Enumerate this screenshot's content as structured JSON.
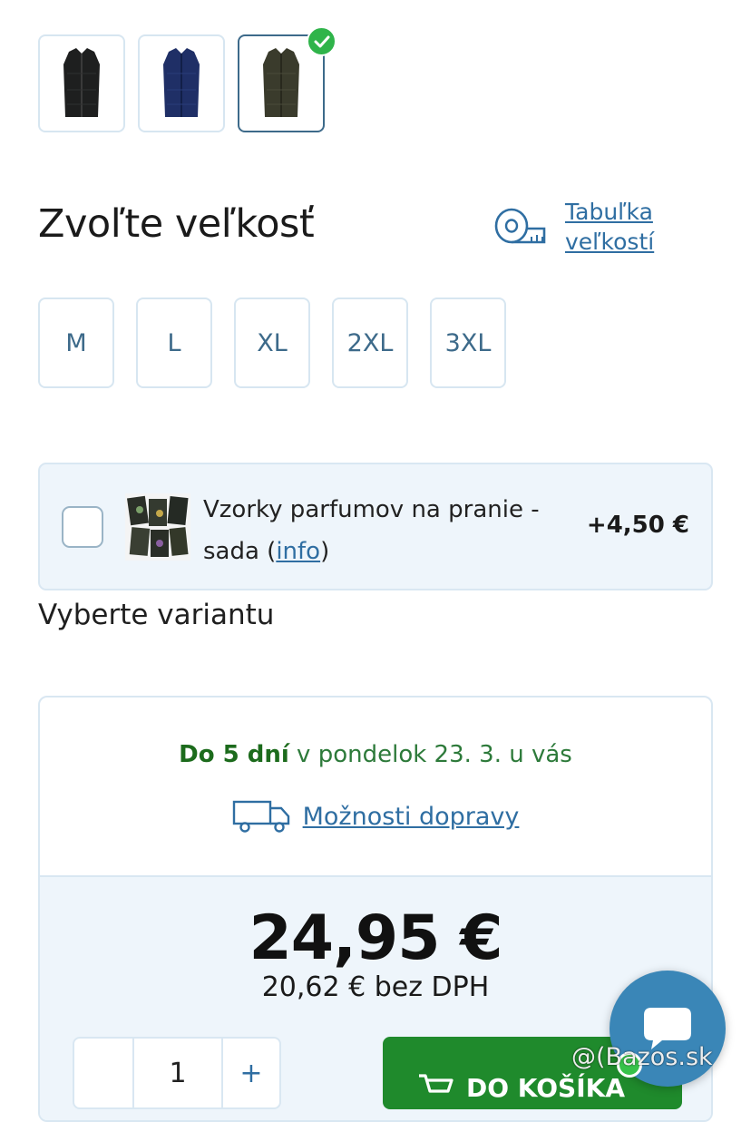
{
  "swatches": [
    {
      "name": "black",
      "color": "#1e1f1f"
    },
    {
      "name": "navy",
      "color": "#1f2f66"
    },
    {
      "name": "olive",
      "color": "#3a3b2c",
      "selected": true
    }
  ],
  "size_section": {
    "title": "Zvoľte veľkosť",
    "size_table_link_line1": "Tabuľka",
    "size_table_link_line2": "veľkostí",
    "sizes": [
      "M",
      "L",
      "XL",
      "2XL",
      "3XL"
    ]
  },
  "addon": {
    "text_main": "Vzorky parfumov na pranie - sada (",
    "info_link": "info",
    "text_close": ")",
    "price": "+4,50 €"
  },
  "variant_note": "Vyberte variantu",
  "delivery": {
    "days": "Do 5 dní",
    "rest": " v pondelok 23. 3. u vás",
    "shipping_link": "Možnosti dopravy"
  },
  "price": {
    "main": "24,95 €",
    "net": "20,62 € bez DPH"
  },
  "quantity": {
    "minus": "",
    "value": "1",
    "plus": "+"
  },
  "cart_button_label": "DO KOŠÍKA",
  "watermark": "@(Bazos.sk",
  "colors": {
    "link": "#2f6ea2",
    "green": "#1f8a2c",
    "border": "#d7e6f1",
    "panel": "#eef5fb"
  }
}
